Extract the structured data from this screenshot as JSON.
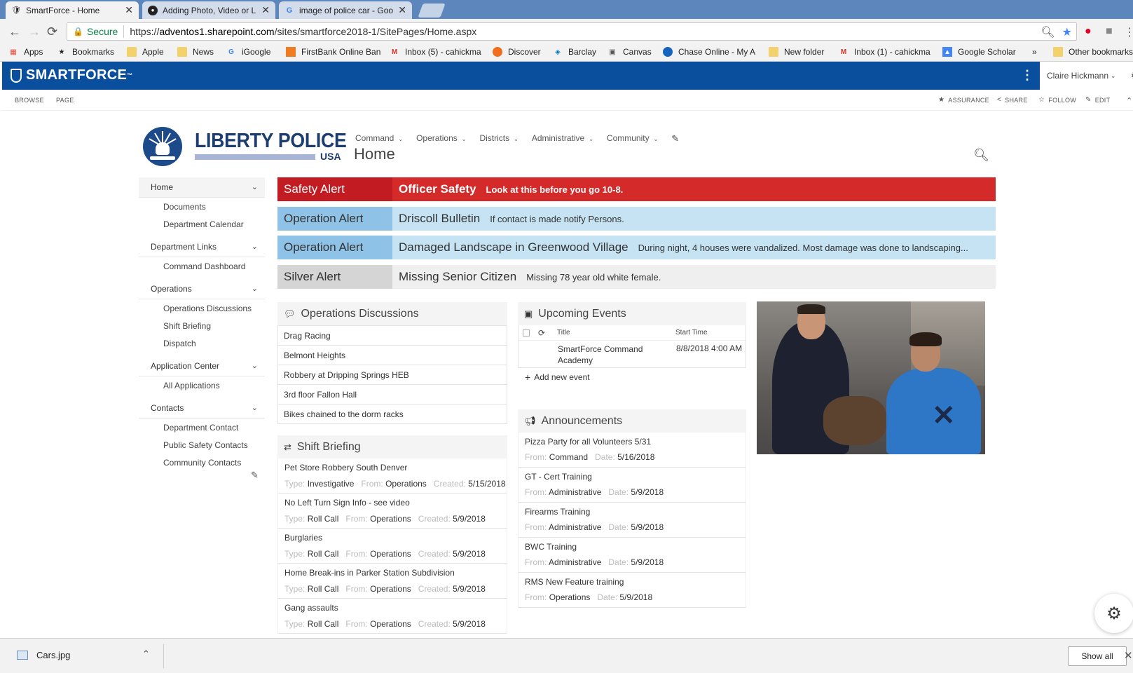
{
  "browser": {
    "tabs": [
      {
        "title": "SmartForce - Home",
        "icon": "shield-icon",
        "active": true
      },
      {
        "title": "Adding Photo, Video or L",
        "icon": "github-icon",
        "active": false
      },
      {
        "title": "image of police car - Goo",
        "icon": "google-icon",
        "active": false
      }
    ],
    "secure_label": "Secure",
    "url_prefix": "https://",
    "url_host": "adventos1.sharepoint.com",
    "url_path": "/sites/smartforce2018-1/SitePages/Home.aspx",
    "bookmarks": [
      {
        "label": "Apps",
        "icon": "apps-grid-icon"
      },
      {
        "label": "Bookmarks",
        "icon": "star-icon"
      },
      {
        "label": "Apple",
        "icon": "folder-icon"
      },
      {
        "label": "News",
        "icon": "folder-icon"
      },
      {
        "label": "iGoogle",
        "icon": "google-icon"
      },
      {
        "label": "FirstBank Online Ban",
        "icon": "bank-icon"
      },
      {
        "label": "Inbox (5) - cahickma",
        "icon": "gmail-icon"
      },
      {
        "label": "Discover",
        "icon": "discover-icon"
      },
      {
        "label": "Barclay",
        "icon": "barclay-icon"
      },
      {
        "label": "Canvas",
        "icon": "canvas-icon"
      },
      {
        "label": "Chase Online - My A",
        "icon": "chase-icon"
      },
      {
        "label": "New folder",
        "icon": "folder-icon"
      },
      {
        "label": "Inbox (1) - cahickma",
        "icon": "gmail-icon"
      },
      {
        "label": "Google Scholar",
        "icon": "scholar-icon"
      },
      {
        "label": "»",
        "icon": ""
      },
      {
        "label": "Other bookmarks",
        "icon": "folder-icon"
      }
    ]
  },
  "suite": {
    "brand": "SMARTFORCE",
    "brand_tm": "™",
    "user": "Claire Hickmann"
  },
  "ribbon": {
    "left": [
      "BROWSE",
      "PAGE"
    ],
    "right": [
      {
        "label": "ASSURANCE",
        "icon": "star-icon"
      },
      {
        "label": "SHARE",
        "icon": "share-icon"
      },
      {
        "label": "FOLLOW",
        "icon": "star-outline-icon"
      },
      {
        "label": "EDIT",
        "icon": "pencil-icon"
      }
    ]
  },
  "site": {
    "logo_name": "LIBERTY POLICE",
    "logo_sub": "USA",
    "nav": [
      "Command",
      "Operations",
      "Districts",
      "Administrative",
      "Community"
    ],
    "page_title": "Home"
  },
  "leftnav": [
    {
      "label": "Home",
      "selected": true,
      "children": [
        "Documents",
        "Department Calendar"
      ]
    },
    {
      "label": "Department Links",
      "selected": false,
      "children": [
        "Command Dashboard"
      ]
    },
    {
      "label": "Operations",
      "selected": false,
      "children": [
        "Operations Discussions",
        "Shift Briefing",
        "Dispatch"
      ]
    },
    {
      "label": "Application Center",
      "selected": false,
      "children": [
        "All Applications"
      ]
    },
    {
      "label": "Contacts",
      "selected": false,
      "children": [
        "Department Contact",
        "Public Safety Contacts",
        "Community Contacts"
      ]
    }
  ],
  "alerts": [
    {
      "category": "Safety Alert",
      "headline": "Officer Safety",
      "text": "Look at this before you go 10-8.",
      "style": "safety"
    },
    {
      "category": "Operation Alert",
      "headline": "Driscoll Bulletin",
      "text": "If contact is made notify Persons.",
      "style": "op"
    },
    {
      "category": "Operation Alert",
      "headline": "Damaged Landscape in Greenwood Village",
      "text": "During night, 4 houses were vandalized. Most damage was done to landscaping...",
      "style": "op"
    },
    {
      "category": "Silver Alert",
      "headline": "Missing Senior Citizen",
      "text": "Missing 78 year old white female.",
      "style": "silver"
    }
  ],
  "discussions": {
    "title": "Operations Discussions",
    "items": [
      "Drag Racing",
      "Belmont Heights",
      "Robbery at Dripping Springs HEB",
      "3rd floor Fallon Hall",
      "Bikes chained to the dorm racks"
    ]
  },
  "shift_briefing": {
    "title": "Shift Briefing",
    "labels": {
      "type": "Type:",
      "from": "From:",
      "created": "Created:"
    },
    "items": [
      {
        "title": "Pet Store Robbery South Denver",
        "type": "Investigative",
        "from": "Operations",
        "created": "5/15/2018"
      },
      {
        "title": "No Left Turn Sign Info - see video",
        "type": "Roll Call",
        "from": "Operations",
        "created": "5/9/2018"
      },
      {
        "title": "Burglaries",
        "type": "Roll Call",
        "from": "Operations",
        "created": "5/9/2018"
      },
      {
        "title": "Home Break-ins in Parker Station Subdivision",
        "type": "Roll Call",
        "from": "Operations",
        "created": "5/9/2018"
      },
      {
        "title": "Gang assaults",
        "type": "Roll Call",
        "from": "Operations",
        "created": "5/9/2018"
      }
    ]
  },
  "events": {
    "title": "Upcoming Events",
    "col_title": "Title",
    "col_start": "Start Time",
    "rows": [
      {
        "title": "SmartForce Command Academy",
        "start": "8/8/2018 4:00 AM"
      }
    ],
    "add_label": "Add new event"
  },
  "announcements": {
    "title": "Announcements",
    "labels": {
      "from": "From:",
      "date": "Date:"
    },
    "items": [
      {
        "title": "Pizza Party for all Volunteers 5/31",
        "from": "Command",
        "date": "5/16/2018"
      },
      {
        "title": "GT - Cert Training",
        "from": "Administrative",
        "date": "5/9/2018"
      },
      {
        "title": "Firearms Training",
        "from": "Administrative",
        "date": "5/9/2018"
      },
      {
        "title": "BWC Training",
        "from": "Administrative",
        "date": "5/9/2018"
      },
      {
        "title": "RMS New Feature training",
        "from": "Operations",
        "date": "5/9/2018"
      }
    ]
  },
  "download": {
    "file": "Cars.jpg",
    "show_all": "Show all"
  },
  "colors": {
    "suite_blue": "#0a4f9e",
    "safety_red": "#d42a2a",
    "op_blue": "#8ec2e6",
    "silver_gray": "#d5d5d5"
  }
}
